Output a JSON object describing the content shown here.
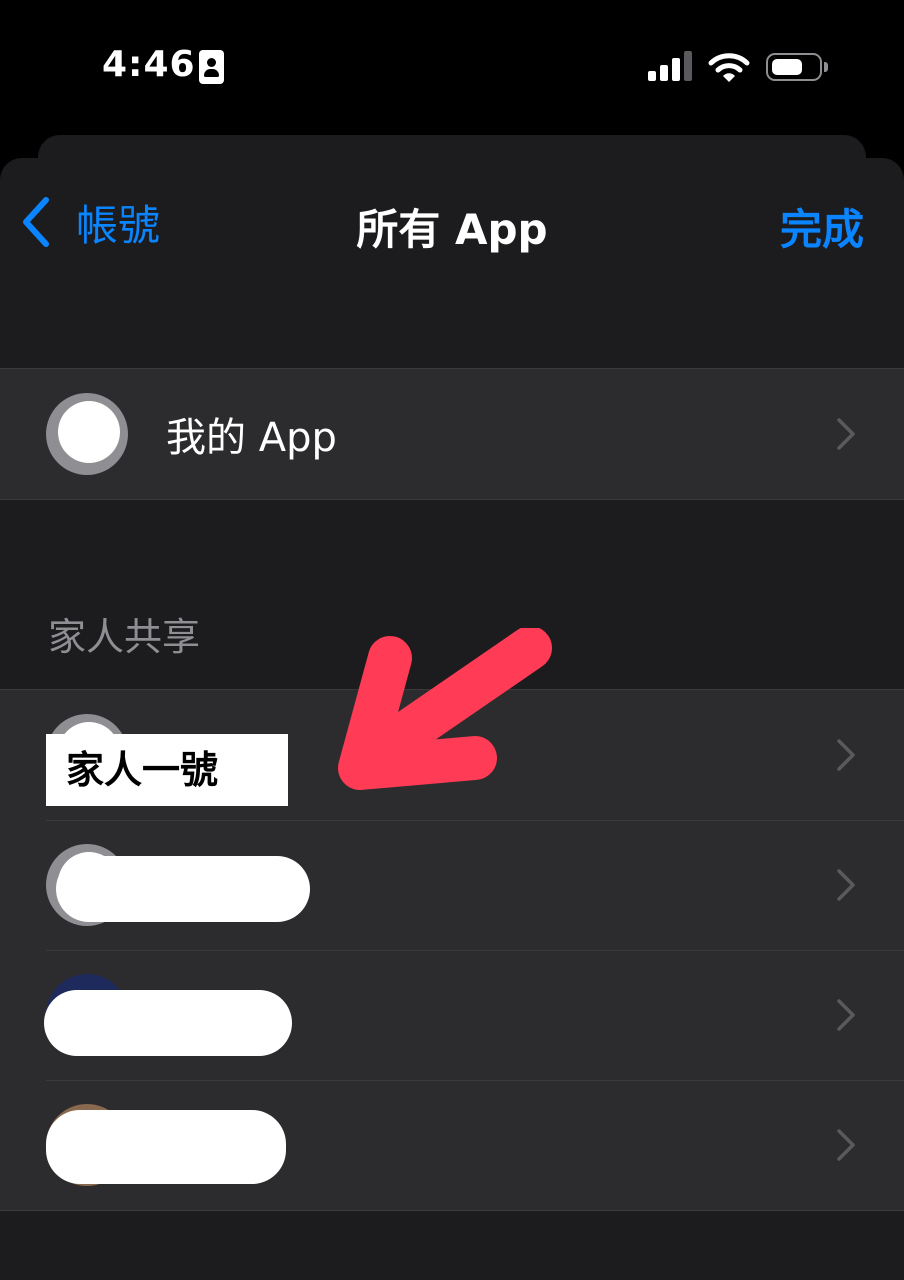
{
  "status_bar": {
    "time": "4:46",
    "icons": [
      "contact-card-icon",
      "cellular-signal-icon",
      "wifi-icon",
      "battery-icon"
    ]
  },
  "nav": {
    "back_label": "帳號",
    "title": "所有 App",
    "done_label": "完成"
  },
  "my_apps": {
    "label": "我的 App"
  },
  "family_sharing": {
    "header": "家人共享",
    "members": [
      {
        "label": "家人一號",
        "redacted": false
      },
      {
        "label": "",
        "redacted": true
      },
      {
        "label": "",
        "redacted": true
      },
      {
        "label": "",
        "redacted": true
      }
    ]
  },
  "colors": {
    "accent": "#0a84ff",
    "background": "#1c1c1e",
    "cell": "#2c2c2e",
    "secondary_text": "#8e8e93",
    "annotation_arrow": "#ff3b55"
  }
}
